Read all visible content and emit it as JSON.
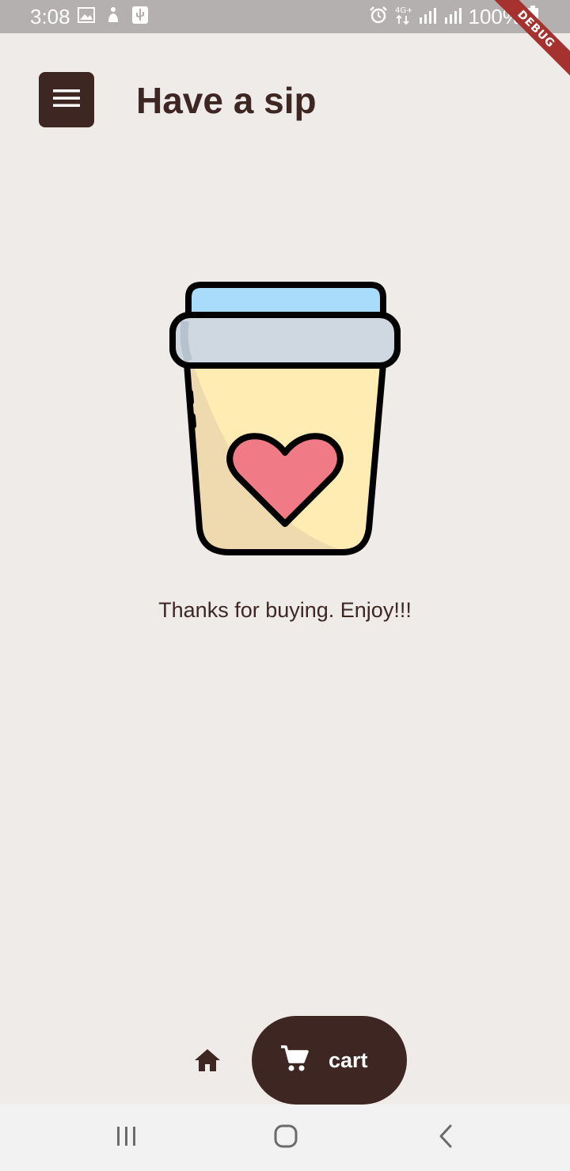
{
  "status_bar": {
    "time": "3:08",
    "battery_text": "100%",
    "network_label": "4G+",
    "debug_label": "DEBUG",
    "icons": [
      "image-icon",
      "accessibility-icon",
      "usb-icon",
      "alarm-icon",
      "network-4g-icon",
      "signal-icon",
      "signal-icon-2",
      "battery-icon"
    ]
  },
  "header": {
    "title": "Have a sip",
    "menu_icon": "menu-icon"
  },
  "main": {
    "illustration": "coffee-cup-heart-illustration",
    "message": "Thanks for buying. Enjoy!!!"
  },
  "bottom_nav": {
    "home_icon": "home-icon",
    "cart_icon": "cart-icon",
    "cart_label": "cart"
  },
  "system_nav": {
    "icons": [
      "recents-icon",
      "home-circle-icon",
      "back-icon"
    ]
  },
  "colors": {
    "primary": "#3e2723",
    "background": "#efebe9",
    "status_bar": "#b3b0af",
    "cup_body": "#ffecb3",
    "cup_lid": "#cfd8e0",
    "cup_top": "#a8dcfa",
    "heart": "#f07b87",
    "debug_ribbon": "#a5322f"
  }
}
